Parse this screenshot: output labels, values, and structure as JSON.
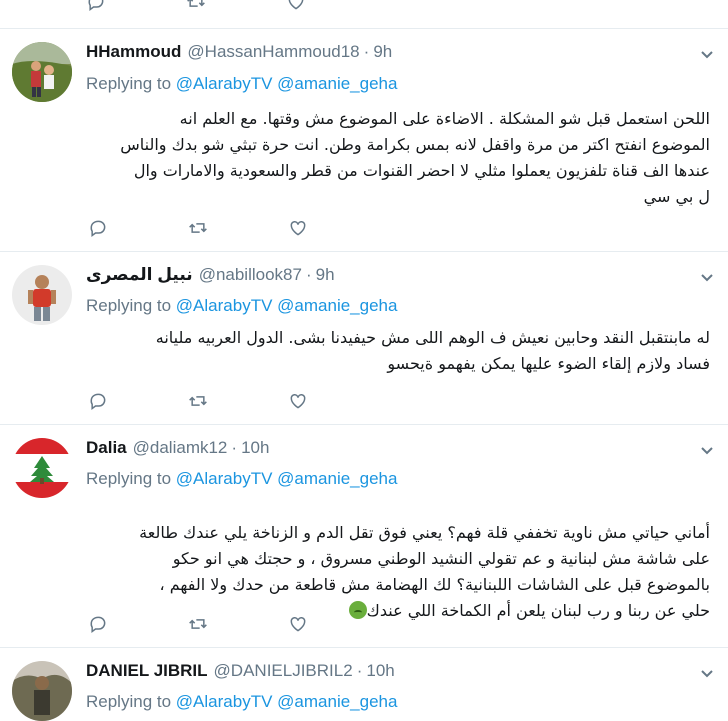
{
  "colors": {
    "link": "#1b95e0",
    "secondary_text": "#657786",
    "icon": "#657786",
    "divider": "#e6ecf0"
  },
  "top_actions": [
    "reply-icon",
    "retweet-icon",
    "like-icon"
  ],
  "tweets": [
    {
      "name": "HHammoud",
      "handle": "@HassanHammoud18",
      "time": "9h",
      "replying_label": "Replying to",
      "mentions": [
        "@AlarabyTV",
        "@amanie_geha"
      ],
      "text": "اللحن استعمل قبل شو المشكلة . الاضاءة على الموضوع مش وقتها. مع العلم انه\nالموضوع انفتح اكتر من مرة واقفل لانه بمس بكرامة وطن. انت حرة تبثي شو بدك والناس\nعندها الف قناة تلفزيون يعملوا مثلي لا احضر القنوات من قطر والسعودية والامارات وال\nل بي سي",
      "avatar_icon": "user-photo"
    },
    {
      "name": "نبيل المصرى",
      "handle": "@nabillook87",
      "time": "9h",
      "replying_label": "Replying to",
      "mentions": [
        "@AlarabyTV",
        "@amanie_geha"
      ],
      "text": "له مابنتقبل النقد وحابين نعيش ف الوهم اللى مش حيفيدنا بشى. الدول العربيه مليانه\nفساد ولازم إلقاء الضوء عليها يمكن يفهمو ةيحسو",
      "avatar_icon": "user-photo"
    },
    {
      "name": "Dalia",
      "handle": "@daliamk12",
      "time": "10h",
      "replying_label": "Replying to",
      "mentions": [
        "@AlarabyTV",
        "@amanie_geha"
      ],
      "text": "أماني حياتي مش ناوية تخففي قلة فهم؟ يعني فوق تقل الدم و الزناخة يلي عندك طالعة\nعلى شاشة مش لبنانية و عم تقولي النشيد الوطني مسروق ، و حجتك هي انو حكو\nبالموضوع قبل على الشاشات اللبنانية؟ لك الهضامة مش قاطعة من حدك ولا الفهم ،\nحلي عن ربنا و رب لبنان يلعن أم الكماخة اللي عندك",
      "emoji": "nauseated-face-emoji",
      "avatar_icon": "cedar-flag"
    },
    {
      "name": "DANIEL JIBRIL",
      "handle": "@DANIELJIBRIL2",
      "time": "10h",
      "replying_label": "Replying to",
      "mentions": [
        "@AlarabyTV",
        "@amanie_geha"
      ],
      "avatar_icon": "user-photo"
    }
  ]
}
